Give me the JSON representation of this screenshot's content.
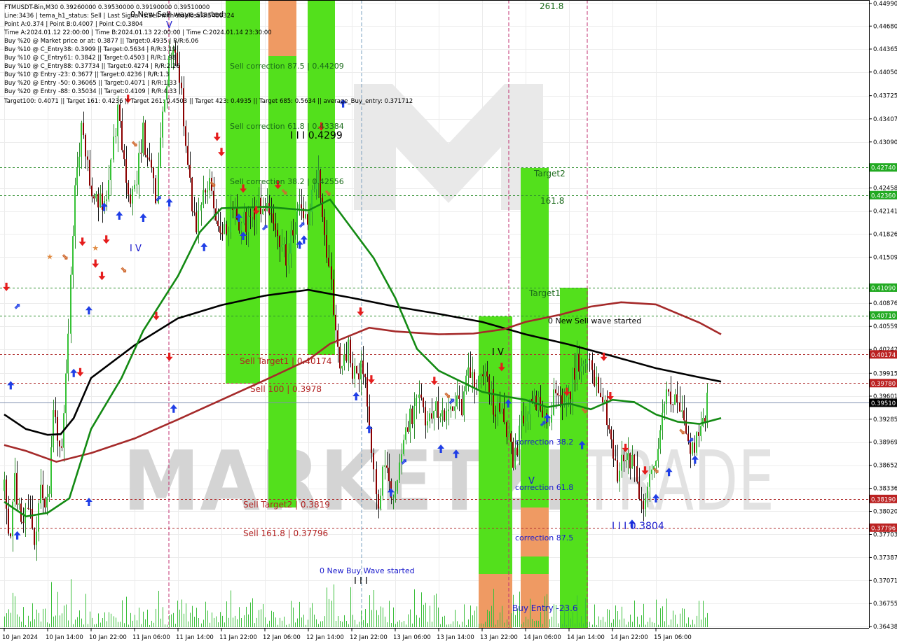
{
  "info": {
    "lines": [
      "FTMUSDT-Bin,M30  0.39260000 0.39530000 0.39190000 0.39510000",
      "Line:3436 | tema_h1_status: Sell | Last Signal is:Sell with stoploss:0.5486324",
      "Point A:0.374 | Point B:0.4007 | Point C:0.3804",
      "Time A:2024.01.12 22:00:00 | Time B:2024.01.13 22:00:00 | Time C:2024.01.14 23:30:00",
      "Buy %20 @ Market price or at: 0.3877 || Target:0.4935 | R/R:6.06",
      "Buy %10 @ C_Entry38: 0.3909 || Target:0.5634 | R/R:3.19",
      "Buy %10 @ C_Entry61: 0.3842 || Target:0.4503 | R/R:1.98",
      "Buy %10 @ C_Entry88: 0.37734 || Target:0.4274 | R/R:2.26",
      "Buy %10 @ Entry -23: 0.3677 || Target:0.4236 | R/R:1.3",
      "Buy %20 @ Entry -50: 0.36065 || Target:0.4071 | R/R:1.33",
      "Buy %20 @ Entry -88: 0.35034 || Target:0.4109 | R/R:4.33",
      "Target100: 0.4071 || Target 161: 0.4236 || Target 261: 0.4503 || Target 423: 0.4935 || Target 685: 0.5634 || average_Buy_entry: 0.371712"
    ]
  },
  "watermark": {
    "left": "MARKETZI",
    "right": "TRADE"
  },
  "chart_data": {
    "type": "candlestick",
    "symbol": "FTMUSDT-Bin",
    "timeframe": "M30",
    "ohlc_last": {
      "open": 0.3926,
      "high": 0.3953,
      "low": 0.3919,
      "close": 0.3951
    },
    "ylim": [
      0.3643,
      0.4499
    ],
    "y_ticks": [
      "0.44990",
      "0.44680",
      "0.44365",
      "0.44050",
      "0.43725",
      "0.43407",
      "0.43090",
      "0.42458",
      "0.42141",
      "0.41826",
      "0.41509",
      "0.40876",
      "0.40559",
      "0.40242",
      "0.39915",
      "0.39601",
      "0.39285",
      "0.38969",
      "0.38652",
      "0.38336",
      "0.38020",
      "0.37703",
      "0.37387",
      "0.37071",
      "0.36755",
      "0.36438"
    ],
    "x_ticks": [
      "10 Jan 2024",
      "10 Jan 14:00",
      "10 Jan 22:00",
      "11 Jan 06:00",
      "11 Jan 14:00",
      "11 Jan 22:00",
      "12 Jan 06:00",
      "12 Jan 14:00",
      "12 Jan 22:00",
      "13 Jan 06:00",
      "13 Jan 14:00",
      "13 Jan 22:00",
      "14 Jan 06:00",
      "14 Jan 14:00",
      "14 Jan 22:00",
      "15 Jan 06:00"
    ],
    "price_tags": [
      {
        "value": 0.4274,
        "label": "0.42740",
        "color": "#22aa22"
      },
      {
        "value": 0.4236,
        "label": "0.42360",
        "color": "#22aa22"
      },
      {
        "value": 0.4109,
        "label": "0.41090",
        "color": "#22aa22"
      },
      {
        "value": 0.4071,
        "label": "0.40710",
        "color": "#22aa22"
      },
      {
        "value": 0.40174,
        "label": "0.40174",
        "color": "#bb2222"
      },
      {
        "value": 0.3978,
        "label": "0.39780",
        "color": "#bb2222"
      },
      {
        "value": 0.3951,
        "label": "0.39510",
        "color": "#000000"
      },
      {
        "value": 0.3819,
        "label": "0.38190",
        "color": "#bb2222"
      },
      {
        "value": 0.37796,
        "label": "0.37796",
        "color": "#bb2222"
      }
    ],
    "series": {
      "sma_black": [
        [
          0,
          0.3935
        ],
        [
          0.5,
          0.3915
        ],
        [
          1,
          0.3907
        ],
        [
          1.3,
          0.3908
        ],
        [
          1.6,
          0.393
        ],
        [
          2,
          0.3985
        ],
        [
          3,
          0.403
        ],
        [
          4,
          0.4067
        ],
        [
          5,
          0.4085
        ],
        [
          6,
          0.4098
        ],
        [
          7,
          0.4106
        ],
        [
          8,
          0.4095
        ],
        [
          9,
          0.4083
        ],
        [
          10,
          0.4073
        ],
        [
          11,
          0.4062
        ],
        [
          12,
          0.4045
        ],
        [
          13,
          0.4031
        ],
        [
          14,
          0.4015
        ],
        [
          15,
          0.39985
        ],
        [
          16,
          0.3986
        ],
        [
          16.5,
          0.398
        ]
      ],
      "sma_darkred": [
        [
          0,
          0.3893
        ],
        [
          0.5,
          0.3885
        ],
        [
          1.2,
          0.387
        ],
        [
          2,
          0.3882
        ],
        [
          3,
          0.3902
        ],
        [
          4,
          0.3928
        ],
        [
          5,
          0.3955
        ],
        [
          6,
          0.3982
        ],
        [
          7,
          0.401
        ],
        [
          7.5,
          0.4032
        ],
        [
          8.4,
          0.4054
        ],
        [
          9,
          0.4049
        ],
        [
          10,
          0.4045
        ],
        [
          10.8,
          0.4046
        ],
        [
          11.5,
          0.4052
        ],
        [
          12,
          0.4062
        ],
        [
          12.8,
          0.4072
        ],
        [
          13.5,
          0.4083
        ],
        [
          14.2,
          0.4089
        ],
        [
          15,
          0.4086
        ],
        [
          16,
          0.4061
        ],
        [
          16.5,
          0.4045
        ]
      ],
      "ema_green": [
        [
          0,
          0.3815
        ],
        [
          0.5,
          0.3795
        ],
        [
          1,
          0.38
        ],
        [
          1.5,
          0.382
        ],
        [
          2,
          0.3915
        ],
        [
          2.7,
          0.3985
        ],
        [
          3.2,
          0.405
        ],
        [
          4,
          0.4125
        ],
        [
          4.5,
          0.4185
        ],
        [
          5,
          0.4218
        ],
        [
          6,
          0.422
        ],
        [
          7,
          0.4215
        ],
        [
          7.5,
          0.423
        ],
        [
          8,
          0.419
        ],
        [
          8.5,
          0.415
        ],
        [
          9,
          0.4095
        ],
        [
          9.5,
          0.4025
        ],
        [
          10,
          0.3995
        ],
        [
          11,
          0.3966
        ],
        [
          11.5,
          0.396
        ],
        [
          12,
          0.3955
        ],
        [
          12.5,
          0.3945
        ],
        [
          13,
          0.395
        ],
        [
          13.5,
          0.3942
        ],
        [
          14,
          0.3955
        ],
        [
          14.5,
          0.3952
        ],
        [
          15,
          0.3935
        ],
        [
          15.5,
          0.3925
        ],
        [
          16,
          0.3922
        ],
        [
          16.5,
          0.393
        ]
      ]
    },
    "zones": [
      {
        "label": "Sell correction 87.5 | 0.44209"
      },
      {
        "label": "Sell correction 61.8 | 0.43384"
      },
      {
        "label": "Sell correction 38.2 | 0.42556"
      },
      {
        "label": "Sell Target1 | 0.40174"
      },
      {
        "label": "Sell 100 | 0.3978"
      },
      {
        "label": "Sell Target2 | 0.3819"
      },
      {
        "label": "Sell 161.8 | 0.37796"
      },
      {
        "label": "261.8"
      },
      {
        "label": "Target2"
      },
      {
        "label": "161.8"
      },
      {
        "label": "Target1"
      },
      {
        "label": "correction 38.2"
      },
      {
        "label": "correction 61.8"
      },
      {
        "label": "correction 87.5"
      },
      {
        "label": "Buy Entry -23.6"
      }
    ],
    "annotations": [
      {
        "text": "0 New Sell wave started"
      },
      {
        "text": "0 New Sell wave started"
      },
      {
        "text": "0 New Buy Wave started"
      },
      {
        "text": "I I I 0.4299"
      },
      {
        "text": "I I I 0.3804"
      },
      {
        "text": "V"
      },
      {
        "text": "V"
      },
      {
        "text": "I V"
      },
      {
        "text": "I V"
      },
      {
        "text": "I I I"
      }
    ]
  }
}
